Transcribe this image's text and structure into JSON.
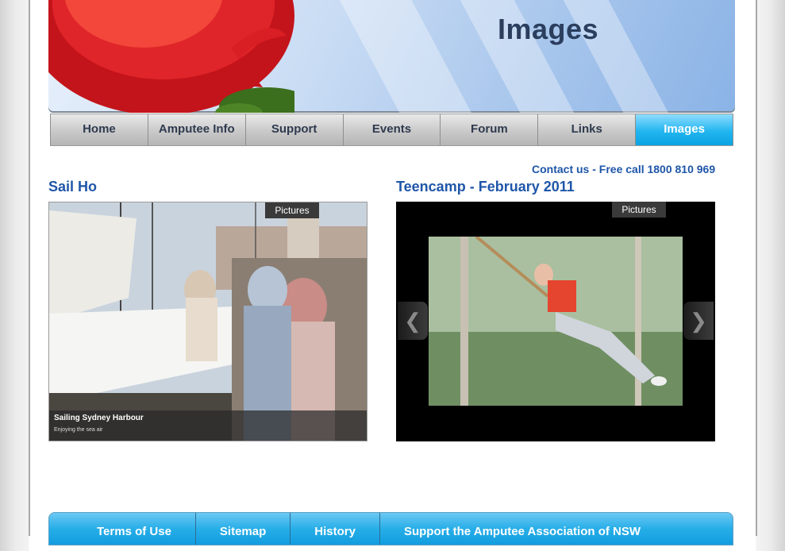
{
  "header": {
    "title": "Images"
  },
  "nav": {
    "items": [
      {
        "label": "Home"
      },
      {
        "label": "Amputee Info"
      },
      {
        "label": "Support"
      },
      {
        "label": "Events"
      },
      {
        "label": "Forum"
      },
      {
        "label": "Links"
      },
      {
        "label": "Images"
      }
    ],
    "active": "Images"
  },
  "contact": {
    "text": "Contact us - Free call 1800 810 969"
  },
  "galleries": [
    {
      "title": "Sail Ho",
      "tab_label": "Pictures",
      "caption_title": "Sailing Sydney Harbour",
      "caption_subtitle": "Enjoying the sea air"
    },
    {
      "title": "Teencamp - February 2011",
      "tab_label": "Pictures"
    }
  ],
  "footer": {
    "links": [
      {
        "label": "Terms of Use"
      },
      {
        "label": "Sitemap"
      },
      {
        "label": "History"
      },
      {
        "label": "Support the Amputee Association of NSW"
      }
    ]
  },
  "colors": {
    "link_blue": "#1f56a8",
    "nav_active": "#22b6f0",
    "footer_bar": "#27aee8"
  },
  "icons": {
    "gallery_prev": "chevron-left-icon",
    "gallery_next": "chevron-right-icon"
  }
}
